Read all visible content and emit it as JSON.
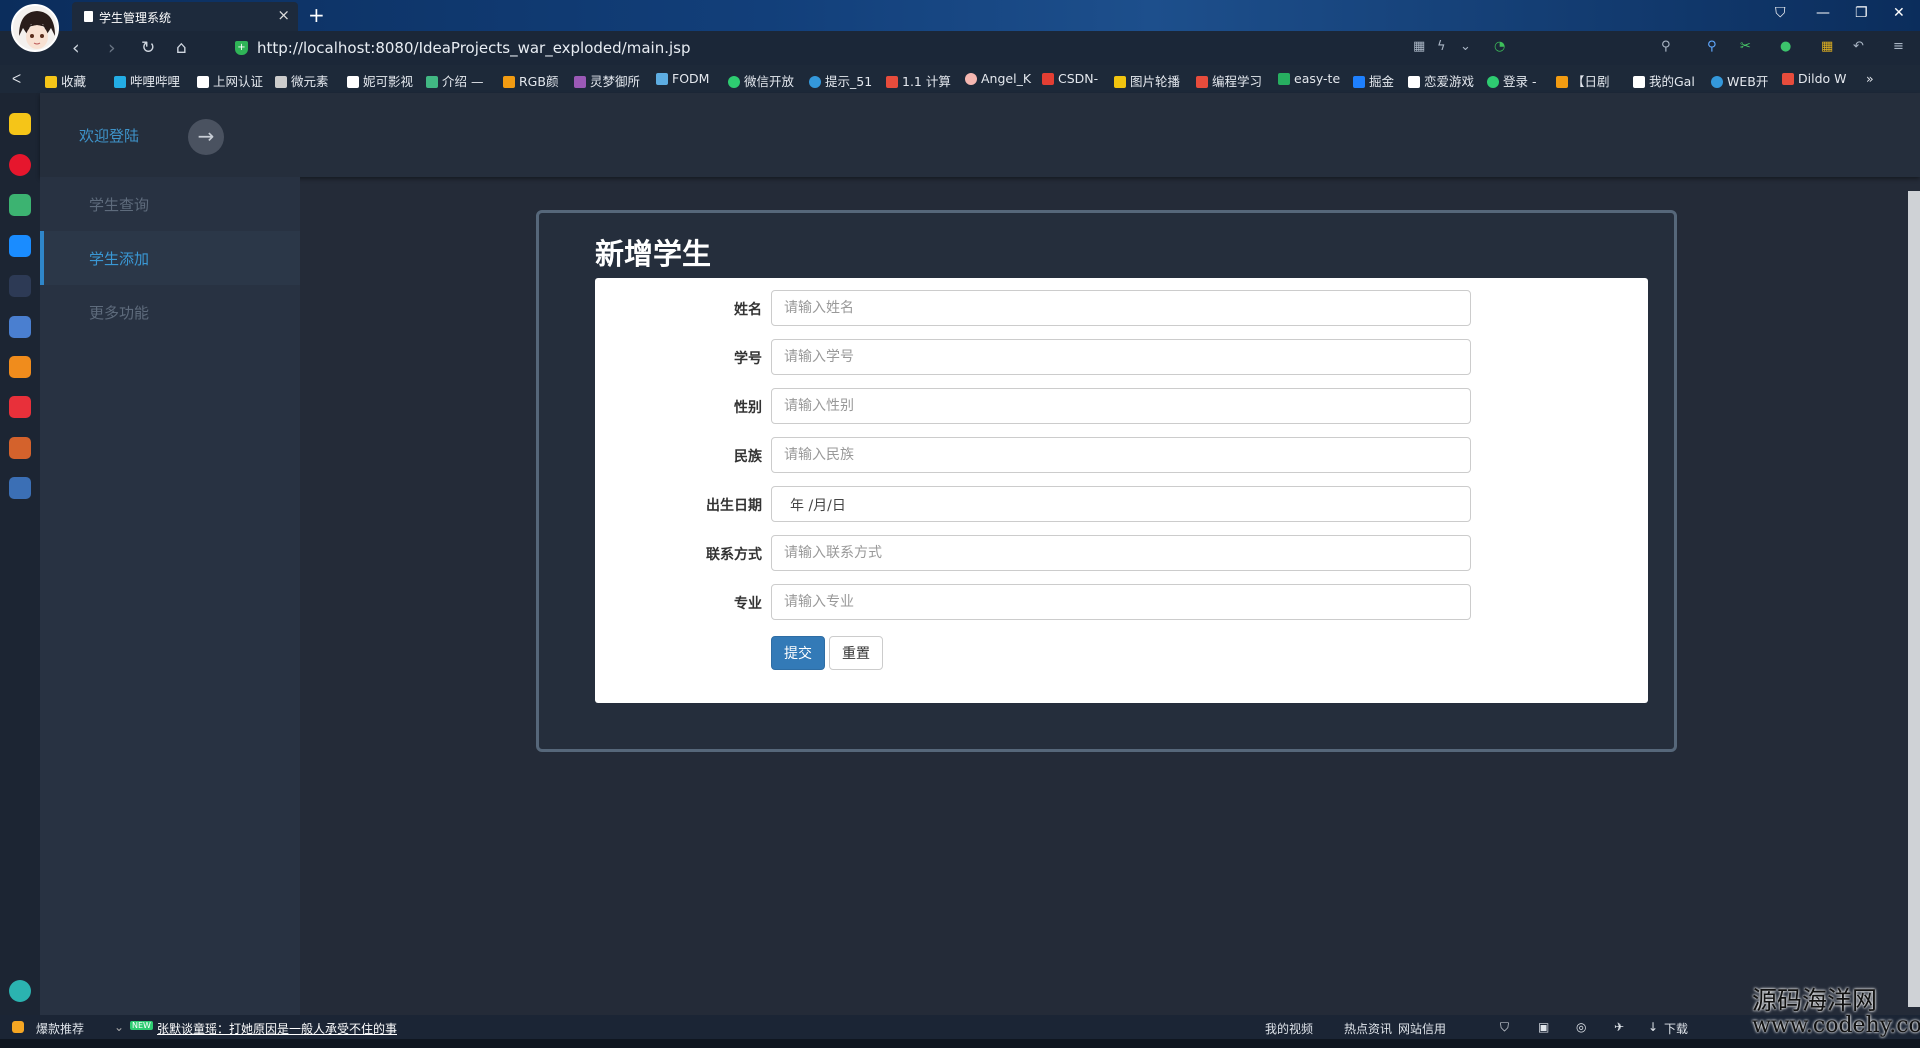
{
  "browser": {
    "tab_title": "学生管理系统",
    "tab_close": "×",
    "new_tab": "+",
    "url": "http://localhost:8080/IdeaProjects_war_exploded/main.jsp"
  },
  "bookmarks": [
    {
      "label": "收藏",
      "color": "#f5c518"
    },
    {
      "label": "哔哩哔哩",
      "color": "#23ade5"
    },
    {
      "label": "上网认证",
      "color": "#ffffff"
    },
    {
      "label": "微元素",
      "color": "#cccccc"
    },
    {
      "label": "妮可影视",
      "color": "#ffffff"
    },
    {
      "label": "介绍 —",
      "color": "#41b883"
    },
    {
      "label": "RGB颜",
      "color": "#f39c12"
    },
    {
      "label": "灵梦御所",
      "color": "#9b59b6"
    },
    {
      "label": "FODM",
      "color": "#5dade2"
    },
    {
      "label": "微信开放",
      "color": "#2ecc71"
    },
    {
      "label": "提示_51",
      "color": "#3498db"
    },
    {
      "label": "1.1 计算",
      "color": "#e74c3c"
    },
    {
      "label": "Angel_K",
      "color": "#f5b7b1"
    },
    {
      "label": "CSDN-",
      "color": "#e33e33"
    },
    {
      "label": "图片轮播",
      "color": "#f1c40f"
    },
    {
      "label": "编程学习",
      "color": "#e74c3c"
    },
    {
      "label": "easy-te",
      "color": "#27ae60"
    },
    {
      "label": "掘金",
      "color": "#1e80ff"
    },
    {
      "label": "恋爱游戏",
      "color": "#ffffff"
    },
    {
      "label": "登录 -",
      "color": "#2ecc71"
    },
    {
      "label": "【日剧",
      "color": "#f39c12"
    },
    {
      "label": "我的Gal",
      "color": "#ffffff"
    },
    {
      "label": "WEB开",
      "color": "#3498db"
    },
    {
      "label": "Dildo W",
      "color": "#e74c3c"
    }
  ],
  "header": {
    "welcome": "欢迎登陆",
    "arrow": "→"
  },
  "menu": {
    "items": [
      {
        "label": "学生查询",
        "active": false
      },
      {
        "label": "学生添加",
        "active": true
      },
      {
        "label": "更多功能",
        "active": false
      }
    ]
  },
  "form": {
    "title": "新增学生",
    "fields": {
      "name": {
        "label": "姓名",
        "placeholder": "请输入姓名"
      },
      "id": {
        "label": "学号",
        "placeholder": "请输入学号"
      },
      "gender": {
        "label": "性别",
        "placeholder": "请输入性别"
      },
      "ethnicity": {
        "label": "民族",
        "placeholder": "请输入民族"
      },
      "birthday": {
        "label": "出生日期",
        "value": "年 /月/日"
      },
      "contact": {
        "label": "联系方式",
        "placeholder": "请输入联系方式"
      },
      "major": {
        "label": "专业",
        "placeholder": "请输入专业"
      }
    },
    "submit_label": "提交",
    "reset_label": "重置"
  },
  "statusbar": {
    "left": "爆款推荐",
    "badge": "NEW",
    "news": "张默谈童瑶：打她原因是一般人承受不住的事",
    "items": [
      "我的视频",
      "热点资讯",
      "网站信用",
      "下载"
    ]
  },
  "watermark": {
    "line1": "源码海洋网",
    "line2": "www.codehy.com"
  },
  "colors": {
    "accent": "#337ab7",
    "menu_active": "#3a98d5",
    "welcome": "#3e93c9"
  }
}
